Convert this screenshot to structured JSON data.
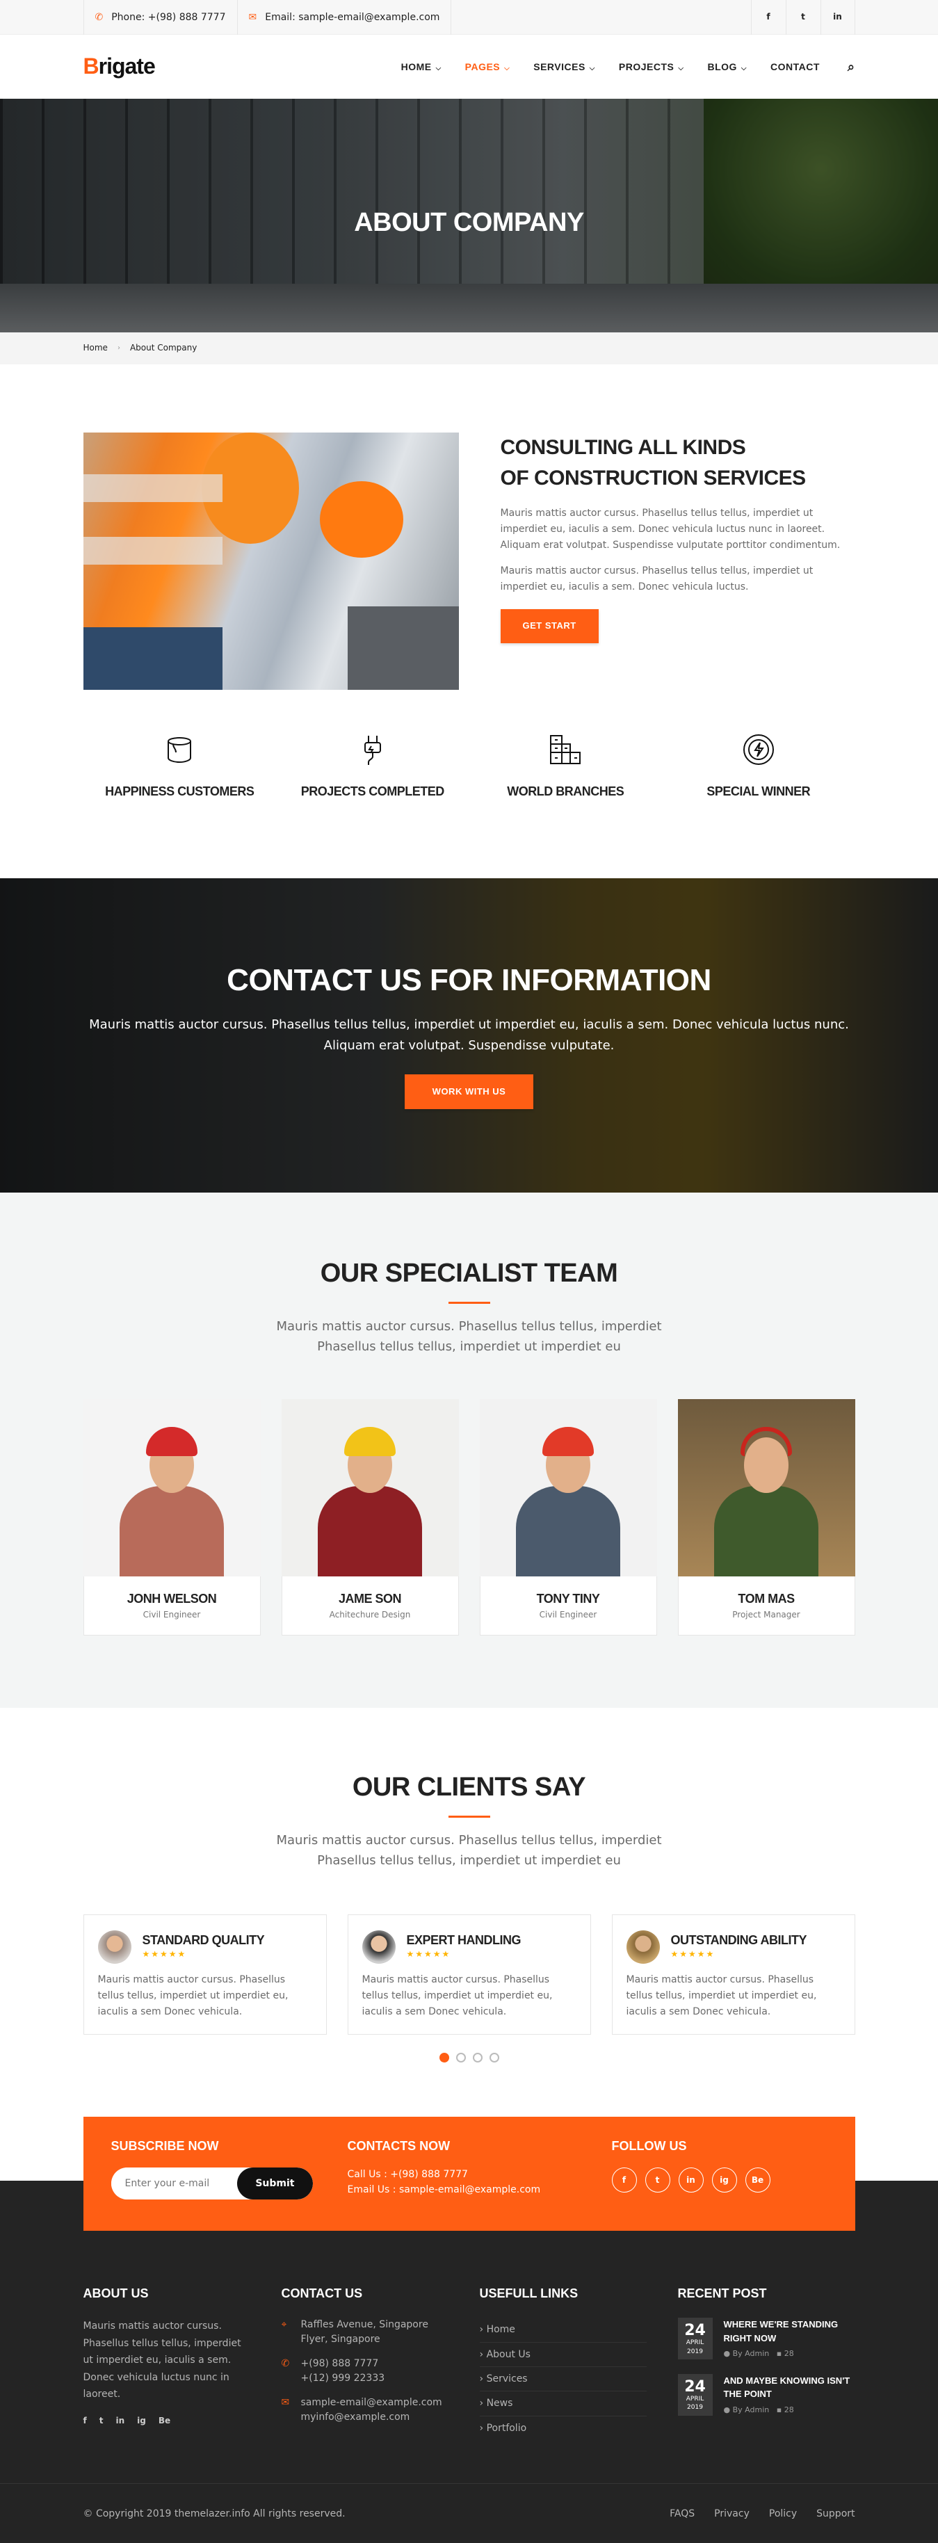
{
  "topbar": {
    "phone": "Phone: +(98) 888 7777",
    "email": "Email: sample-email@example.com",
    "social": [
      "f",
      "t",
      "in"
    ]
  },
  "header": {
    "logo_first": "B",
    "logo_rest": "rigate",
    "nav": [
      "HOME",
      "PAGES",
      "SERVICES",
      "PROJECTS",
      "BLOG",
      "CONTACT"
    ],
    "active": "PAGES"
  },
  "hero": {
    "title": "ABOUT COMPANY"
  },
  "breadcrumb": {
    "home": "Home",
    "current": "About Company"
  },
  "about": {
    "title_line1": "CONSULTING ALL KINDS",
    "title_line2": "OF CONSTRUCTION SERVICES",
    "p1": "Mauris mattis auctor cursus. Phasellus tellus tellus, imperdiet ut imperdiet eu, iaculis a sem. Donec vehicula luctus nunc in laoreet. Aliquam erat volutpat. Suspendisse vulputate porttitor condimentum.",
    "p2": "Mauris mattis auctor cursus. Phasellus tellus tellus, imperdiet ut imperdiet eu, iaculis a sem. Donec vehicula luctus.",
    "button": "GET START"
  },
  "features": [
    {
      "label": "HAPPINESS CUSTOMERS",
      "icon": "paint-bucket-icon"
    },
    {
      "label": "PROJECTS COMPLETED",
      "icon": "plug-icon"
    },
    {
      "label": "WORLD BRANCHES",
      "icon": "building-icon"
    },
    {
      "label": "SPECIAL WINNER",
      "icon": "energy-icon"
    }
  ],
  "cta": {
    "title": "CONTACT US FOR INFORMATION",
    "text": "Mauris mattis auctor cursus. Phasellus tellus tellus, imperdiet ut imperdiet eu, iaculis a sem. Donec vehicula luctus nunc. Aliquam erat volutpat. Suspendisse vulputate.",
    "button": "WORK WITH US"
  },
  "team": {
    "title": "OUR SPECIALIST TEAM",
    "subtitle": "Mauris mattis auctor cursus. Phasellus tellus tellus, imperdiet Phasellus tellus tellus, imperdiet ut imperdiet eu",
    "members": [
      {
        "name": "JONH WELSON",
        "role": "Civil Engineer"
      },
      {
        "name": "JAME SON",
        "role": "Achitechure Design"
      },
      {
        "name": "TONY TINY",
        "role": "Civil Engineer"
      },
      {
        "name": "TOM MAS",
        "role": "Project Manager"
      }
    ]
  },
  "clients": {
    "title": "OUR CLIENTS SAY",
    "subtitle": "Mauris mattis auctor cursus. Phasellus tellus tellus, imperdiet Phasellus tellus tellus, imperdiet ut imperdiet eu",
    "items": [
      {
        "title": "STANDARD QUALITY",
        "text": "Mauris mattis auctor cursus. Phasellus tellus tellus, imperdiet ut imperdiet eu, iaculis a sem Donec vehicula."
      },
      {
        "title": "EXPERT HANDLING",
        "text": "Mauris mattis auctor cursus. Phasellus tellus tellus, imperdiet ut imperdiet eu, iaculis a sem Donec vehicula."
      },
      {
        "title": "OUTSTANDING ABILITY",
        "text": "Mauris mattis auctor cursus. Phasellus tellus tellus, imperdiet ut imperdiet eu, iaculis a sem Donec vehicula."
      }
    ],
    "stars": "★★★★★"
  },
  "subscribe": {
    "title": "SUBSCRIBE NOW",
    "placeholder": "Enter your e-mail",
    "button": "Submit",
    "contacts_title": "CONTACTS NOW",
    "call": "Call Us : +(98) 888 7777",
    "email": "Email Us : sample-email@example.com",
    "follow_title": "FOLLOW US",
    "follow": [
      "f",
      "t",
      "in",
      "ig",
      "Be"
    ]
  },
  "footer": {
    "about_title": "ABOUT US",
    "about_text": "Mauris mattis auctor cursus. Phasellus tellus tellus, imperdiet ut imperdiet eu, iaculis a sem. Donec vehicula luctus nunc in laoreet.",
    "about_social": [
      "f",
      "t",
      "in",
      "ig",
      "Be"
    ],
    "contact_title": "CONTACT US",
    "address": "Raffles Avenue, Singapore Flyer, Singapore",
    "phone1": "+(98) 888 7777",
    "phone2": "+(12) 999 22333",
    "email1": "sample-email@example.com",
    "email2": "myinfo@example.com",
    "links_title": "USEFULL LINKS",
    "links": [
      "Home",
      "About Us",
      "Services",
      "News",
      "Portfolio"
    ],
    "recent_title": "RECENT POST",
    "posts": [
      {
        "day": "24",
        "month": "APRIL",
        "year": "2019",
        "title": "WHERE WE'RE STANDING RIGHT NOW",
        "by": "By Admin",
        "comments": "28"
      },
      {
        "day": "24",
        "month": "APRIL",
        "year": "2019",
        "title": "AND MAYBE KNOWING ISN'T THE POINT",
        "by": "By Admin",
        "comments": "28"
      }
    ],
    "copyright": "© Copyright 2019 themelazer.info All rights reserved.",
    "bottom_links": [
      "FAQS",
      "Privacy",
      "Policy",
      "Support"
    ]
  }
}
